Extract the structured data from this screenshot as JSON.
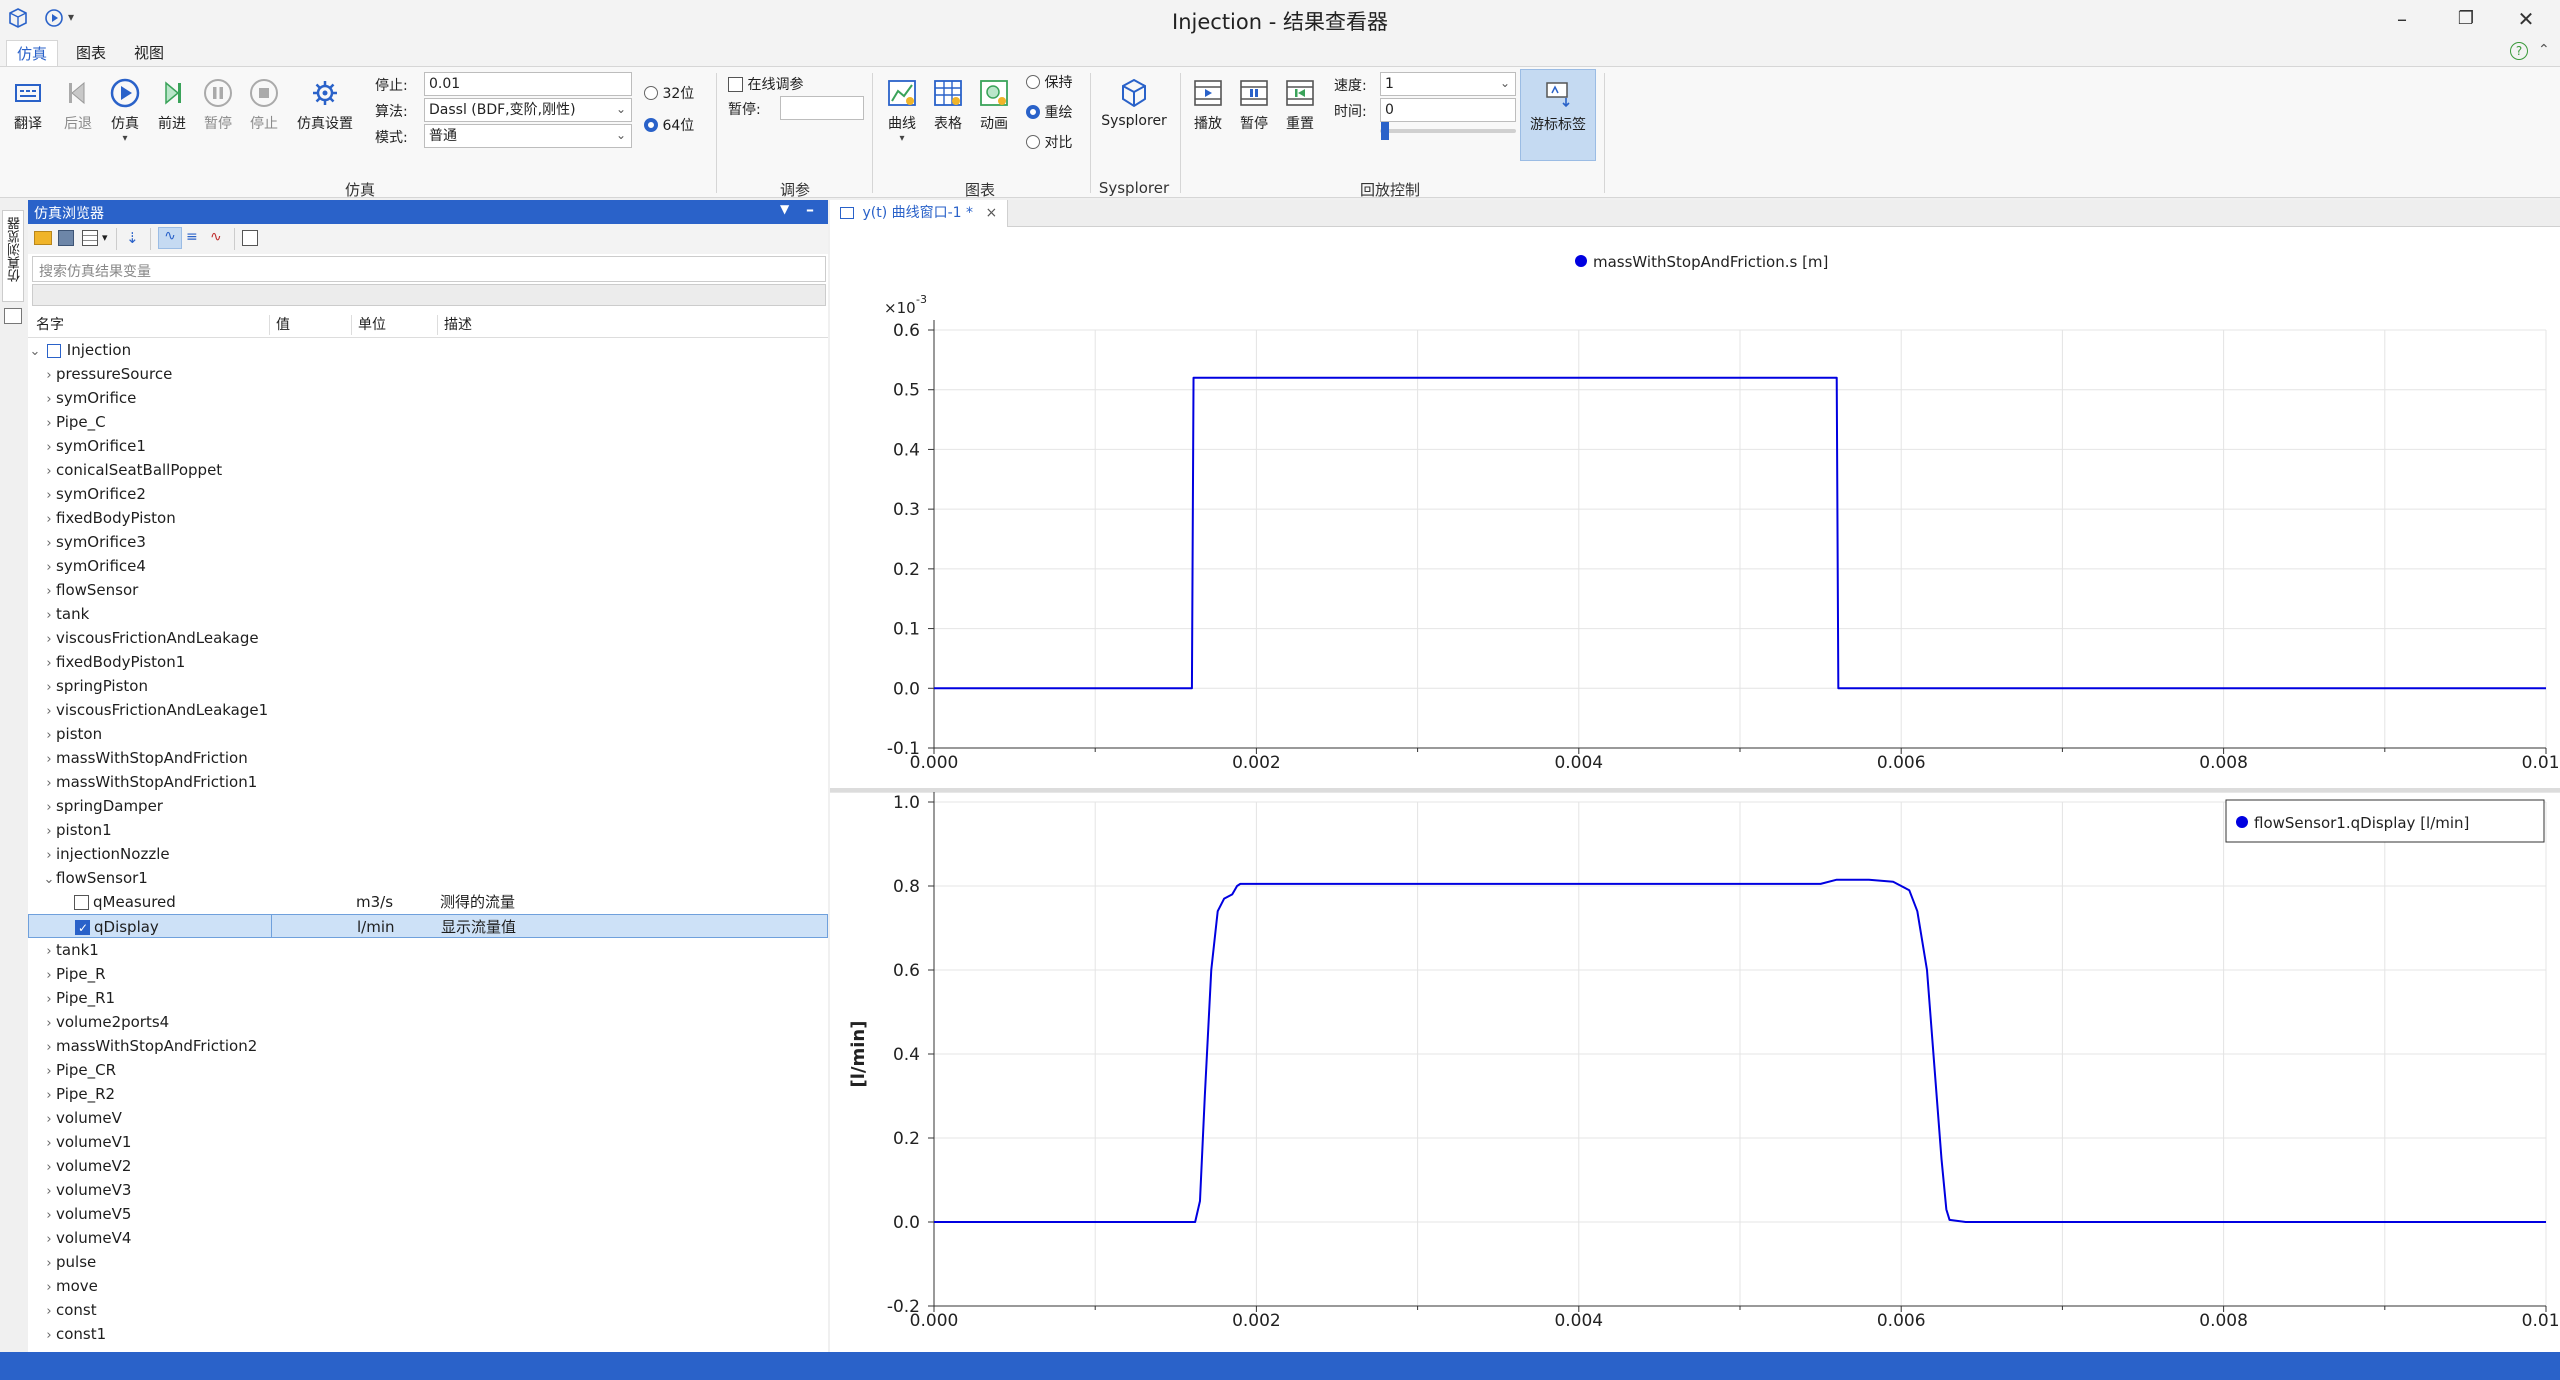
{
  "window": {
    "title": "Injection - 结果查看器",
    "controls": [
      "–",
      "❐",
      "✕"
    ]
  },
  "menu": {
    "tabs": [
      "仿真",
      "图表",
      "视图"
    ],
    "help": "?",
    "collapse": "⌃"
  },
  "ribbon": {
    "sim_group": {
      "buttons": [
        "翻译",
        "后退",
        "仿真",
        "前进",
        "暂停",
        "停止",
        "仿真设置"
      ],
      "stop_label": "停止:",
      "stop_value": "0.01",
      "algo_label": "算法:",
      "algo_value": "Dassl (BDF,变阶,刚性)",
      "mode_label": "模式:",
      "mode_value": "普通",
      "bits": [
        "32位",
        "64位"
      ],
      "bits_selected": "64位",
      "group_label": "仿真"
    },
    "tune_group": {
      "online_label": "在线调参",
      "pause_label": "暂停:",
      "pause_value": "",
      "group_label": "调参"
    },
    "chart_group": {
      "buttons": [
        "曲线",
        "表格",
        "动画"
      ],
      "radios": [
        "保持",
        "重绘",
        "对比"
      ],
      "radio_selected": "重绘",
      "group_label": "图表"
    },
    "sysplorer_group": {
      "button": "Sysplorer",
      "group_label": "Sysplorer"
    },
    "playback_group": {
      "buttons": [
        "播放",
        "暂停",
        "重置"
      ],
      "speed_label": "速度:",
      "speed_value": "1",
      "time_label": "时间:",
      "time_value": "0",
      "cursor_label": "游标标签",
      "group_label": "回放控制"
    }
  },
  "side_strip": {
    "label": "仿真浏览器"
  },
  "browser": {
    "title": "仿真浏览器",
    "search_placeholder": "搜索仿真结果变量",
    "columns": [
      "名字",
      "值",
      "单位",
      "描述"
    ],
    "root": "Injection",
    "items_before": [
      "pressureSource",
      "symOrifice",
      "Pipe_C",
      "symOrifice1",
      "conicalSeatBallPoppet",
      "symOrifice2",
      "fixedBodyPiston",
      "symOrifice3",
      "symOrifice4",
      "flowSensor",
      "tank",
      "viscousFrictionAndLeakage",
      "fixedBodyPiston1",
      "springPiston",
      "viscousFrictionAndLeakage1",
      "piston",
      "massWithStopAndFriction",
      "massWithStopAndFriction1",
      "springDamper",
      "piston1",
      "injectionNozzle"
    ],
    "expanded": "flowSensor1",
    "children": [
      {
        "name": "qMeasured",
        "unit": "m3/s",
        "desc": "测得的流量",
        "checked": false
      },
      {
        "name": "qDisplay",
        "unit": "l/min",
        "desc": "显示流量值",
        "checked": true
      }
    ],
    "items_after": [
      "tank1",
      "Pipe_R",
      "Pipe_R1",
      "volume2ports4",
      "massWithStopAndFriction2",
      "Pipe_CR",
      "Pipe_R2",
      "volumeV",
      "volumeV1",
      "volumeV2",
      "volumeV3",
      "volumeV5",
      "volumeV4",
      "pulse",
      "move",
      "const",
      "const1"
    ]
  },
  "doc_tab": {
    "label": "y(t) 曲线窗口-1 *",
    "close": "×"
  },
  "accent": "#2a62c9",
  "line_color": "#0000e0",
  "chart_data": [
    {
      "type": "line",
      "legend": "massWithStopAndFriction.s [m]",
      "legend_position": "top-center",
      "multiplier": "×10",
      "multiplier_exp": "-3",
      "ylabel": "",
      "xlim": [
        0,
        0.01
      ],
      "ylim": [
        -0.1,
        0.6
      ],
      "xticks": [
        "0.000",
        "0.002",
        "0.004",
        "0.006",
        "0.008",
        "0.010"
      ],
      "yticks": [
        "0.6",
        "0.5",
        "0.4",
        "0.3",
        "0.2",
        "0.1",
        "0.0",
        "-0.1"
      ],
      "grid": true,
      "series": [
        {
          "name": "massWithStopAndFriction.s",
          "x": [
            0,
            0.0016,
            0.00161,
            0.0056,
            0.00561,
            0.01
          ],
          "y": [
            0,
            0,
            0.52,
            0.52,
            0,
            0
          ]
        }
      ]
    },
    {
      "type": "line",
      "legend": "flowSensor1.qDisplay [l/min]",
      "legend_position": "top-right",
      "ylabel": "[l/min]",
      "xlim": [
        0,
        0.01
      ],
      "ylim": [
        -0.2,
        1.0
      ],
      "xticks": [
        "0.000",
        "0.002",
        "0.004",
        "0.006",
        "0.008",
        "0.010"
      ],
      "yticks": [
        "1.0",
        "0.8",
        "0.6",
        "0.4",
        "0.2",
        "0.0",
        "-0.2"
      ],
      "grid": true,
      "series": [
        {
          "name": "flowSensor1.qDisplay",
          "x": [
            0,
            0.00162,
            0.00165,
            0.00168,
            0.00172,
            0.00176,
            0.0018,
            0.00185,
            0.00188,
            0.0019,
            0.0035,
            0.0055,
            0.0056,
            0.0058,
            0.00595,
            0.00605,
            0.0061,
            0.00616,
            0.0062,
            0.00625,
            0.00628,
            0.0063,
            0.0064,
            0.01
          ],
          "y": [
            0,
            0.0,
            0.05,
            0.3,
            0.6,
            0.74,
            0.77,
            0.78,
            0.8,
            0.805,
            0.805,
            0.805,
            0.815,
            0.815,
            0.81,
            0.79,
            0.74,
            0.6,
            0.4,
            0.15,
            0.03,
            0.005,
            0,
            0
          ]
        }
      ]
    }
  ]
}
